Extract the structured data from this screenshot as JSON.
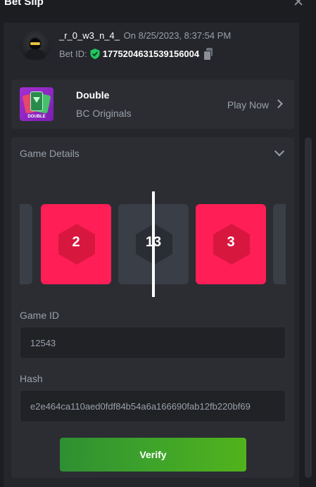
{
  "header": {
    "title": "Bet Slip"
  },
  "user": {
    "name": "_r_0_w3_n_4_",
    "time": "On 8/25/2023, 8:37:54 PM",
    "bet_id_label": "Bet ID:",
    "bet_id": "1775204631539156004"
  },
  "game": {
    "thumb_label": "DOUBLE",
    "name": "Double",
    "provider": "BC Originals",
    "play_label": "Play Now"
  },
  "details": {
    "title": "Game Details",
    "tiles": [
      {
        "number": "",
        "color": "gray"
      },
      {
        "number": "2",
        "color": "red"
      },
      {
        "number": "13",
        "color": "gray"
      },
      {
        "number": "3",
        "color": "red"
      },
      {
        "number": "",
        "color": "gray"
      }
    ],
    "game_id_label": "Game ID",
    "game_id": "12543",
    "hash_label": "Hash",
    "hash": "e2e464ca110aed0fdf84b54a6a166690fab12fb220bf69",
    "verify_label": "Verify"
  },
  "colors": {
    "red": "#ff1e55",
    "gray": "#3a3e47",
    "green": "#3ea42a",
    "shield": "#22c55e"
  }
}
